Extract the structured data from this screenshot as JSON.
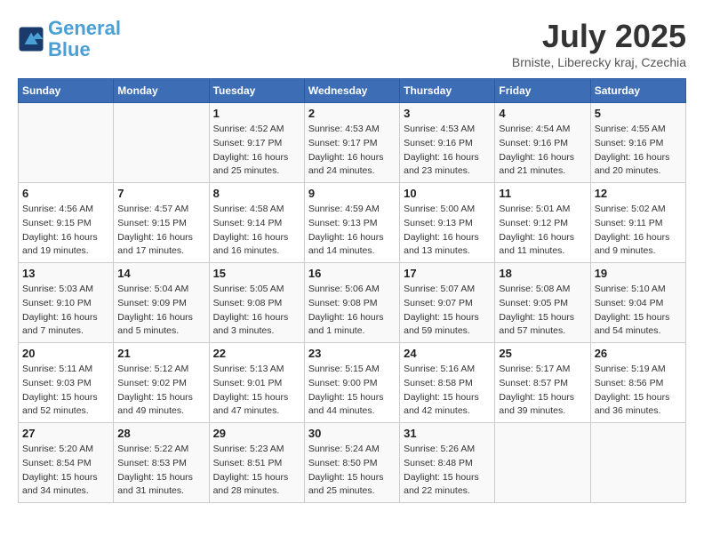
{
  "header": {
    "logo_line1": "General",
    "logo_line2": "Blue",
    "month": "July 2025",
    "location": "Brniste, Liberecky kraj, Czechia"
  },
  "weekdays": [
    "Sunday",
    "Monday",
    "Tuesday",
    "Wednesday",
    "Thursday",
    "Friday",
    "Saturday"
  ],
  "weeks": [
    [
      {
        "day": "",
        "info": ""
      },
      {
        "day": "",
        "info": ""
      },
      {
        "day": "1",
        "info": "Sunrise: 4:52 AM\nSunset: 9:17 PM\nDaylight: 16 hours and 25 minutes."
      },
      {
        "day": "2",
        "info": "Sunrise: 4:53 AM\nSunset: 9:17 PM\nDaylight: 16 hours and 24 minutes."
      },
      {
        "day": "3",
        "info": "Sunrise: 4:53 AM\nSunset: 9:16 PM\nDaylight: 16 hours and 23 minutes."
      },
      {
        "day": "4",
        "info": "Sunrise: 4:54 AM\nSunset: 9:16 PM\nDaylight: 16 hours and 21 minutes."
      },
      {
        "day": "5",
        "info": "Sunrise: 4:55 AM\nSunset: 9:16 PM\nDaylight: 16 hours and 20 minutes."
      }
    ],
    [
      {
        "day": "6",
        "info": "Sunrise: 4:56 AM\nSunset: 9:15 PM\nDaylight: 16 hours and 19 minutes."
      },
      {
        "day": "7",
        "info": "Sunrise: 4:57 AM\nSunset: 9:15 PM\nDaylight: 16 hours and 17 minutes."
      },
      {
        "day": "8",
        "info": "Sunrise: 4:58 AM\nSunset: 9:14 PM\nDaylight: 16 hours and 16 minutes."
      },
      {
        "day": "9",
        "info": "Sunrise: 4:59 AM\nSunset: 9:13 PM\nDaylight: 16 hours and 14 minutes."
      },
      {
        "day": "10",
        "info": "Sunrise: 5:00 AM\nSunset: 9:13 PM\nDaylight: 16 hours and 13 minutes."
      },
      {
        "day": "11",
        "info": "Sunrise: 5:01 AM\nSunset: 9:12 PM\nDaylight: 16 hours and 11 minutes."
      },
      {
        "day": "12",
        "info": "Sunrise: 5:02 AM\nSunset: 9:11 PM\nDaylight: 16 hours and 9 minutes."
      }
    ],
    [
      {
        "day": "13",
        "info": "Sunrise: 5:03 AM\nSunset: 9:10 PM\nDaylight: 16 hours and 7 minutes."
      },
      {
        "day": "14",
        "info": "Sunrise: 5:04 AM\nSunset: 9:09 PM\nDaylight: 16 hours and 5 minutes."
      },
      {
        "day": "15",
        "info": "Sunrise: 5:05 AM\nSunset: 9:08 PM\nDaylight: 16 hours and 3 minutes."
      },
      {
        "day": "16",
        "info": "Sunrise: 5:06 AM\nSunset: 9:08 PM\nDaylight: 16 hours and 1 minute."
      },
      {
        "day": "17",
        "info": "Sunrise: 5:07 AM\nSunset: 9:07 PM\nDaylight: 15 hours and 59 minutes."
      },
      {
        "day": "18",
        "info": "Sunrise: 5:08 AM\nSunset: 9:05 PM\nDaylight: 15 hours and 57 minutes."
      },
      {
        "day": "19",
        "info": "Sunrise: 5:10 AM\nSunset: 9:04 PM\nDaylight: 15 hours and 54 minutes."
      }
    ],
    [
      {
        "day": "20",
        "info": "Sunrise: 5:11 AM\nSunset: 9:03 PM\nDaylight: 15 hours and 52 minutes."
      },
      {
        "day": "21",
        "info": "Sunrise: 5:12 AM\nSunset: 9:02 PM\nDaylight: 15 hours and 49 minutes."
      },
      {
        "day": "22",
        "info": "Sunrise: 5:13 AM\nSunset: 9:01 PM\nDaylight: 15 hours and 47 minutes."
      },
      {
        "day": "23",
        "info": "Sunrise: 5:15 AM\nSunset: 9:00 PM\nDaylight: 15 hours and 44 minutes."
      },
      {
        "day": "24",
        "info": "Sunrise: 5:16 AM\nSunset: 8:58 PM\nDaylight: 15 hours and 42 minutes."
      },
      {
        "day": "25",
        "info": "Sunrise: 5:17 AM\nSunset: 8:57 PM\nDaylight: 15 hours and 39 minutes."
      },
      {
        "day": "26",
        "info": "Sunrise: 5:19 AM\nSunset: 8:56 PM\nDaylight: 15 hours and 36 minutes."
      }
    ],
    [
      {
        "day": "27",
        "info": "Sunrise: 5:20 AM\nSunset: 8:54 PM\nDaylight: 15 hours and 34 minutes."
      },
      {
        "day": "28",
        "info": "Sunrise: 5:22 AM\nSunset: 8:53 PM\nDaylight: 15 hours and 31 minutes."
      },
      {
        "day": "29",
        "info": "Sunrise: 5:23 AM\nSunset: 8:51 PM\nDaylight: 15 hours and 28 minutes."
      },
      {
        "day": "30",
        "info": "Sunrise: 5:24 AM\nSunset: 8:50 PM\nDaylight: 15 hours and 25 minutes."
      },
      {
        "day": "31",
        "info": "Sunrise: 5:26 AM\nSunset: 8:48 PM\nDaylight: 15 hours and 22 minutes."
      },
      {
        "day": "",
        "info": ""
      },
      {
        "day": "",
        "info": ""
      }
    ]
  ]
}
